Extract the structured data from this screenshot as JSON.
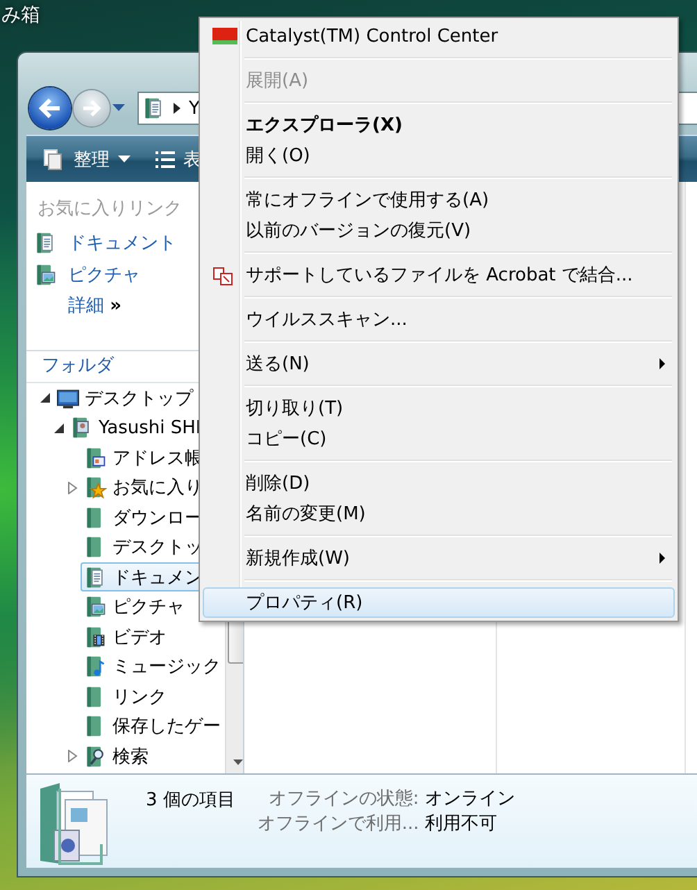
{
  "desktop": {
    "icon_label": "み箱"
  },
  "window": {
    "address": {
      "text": "Y"
    },
    "toolbar": [
      {
        "label": "整理",
        "dropdown": true,
        "kind": "organize"
      },
      {
        "label": "表",
        "dropdown": false,
        "kind": "views"
      }
    ],
    "favorites": {
      "title": "お気に入りリンク",
      "links": [
        {
          "label": "ドキュメント",
          "kind": "documents"
        },
        {
          "label": "ピクチャ",
          "kind": "pictures"
        }
      ],
      "more": "詳細",
      "more_glyph": "»"
    },
    "folders": {
      "title": "フォルダ",
      "tree": [
        {
          "label": "デスクトップ",
          "kind": "desktop",
          "expanded": true,
          "selected": false,
          "children": [
            {
              "label": "Yasushi SHI",
              "kind": "user",
              "expanded": true,
              "selected": false,
              "children": [
                {
                  "label": "アドレス帳",
                  "kind": "contacts",
                  "selected": false
                },
                {
                  "label": "お気に入り",
                  "kind": "favorites",
                  "expanded": false,
                  "selected": false
                },
                {
                  "label": "ダウンロー",
                  "kind": "folder",
                  "selected": false
                },
                {
                  "label": "デスクトッ",
                  "kind": "folder",
                  "selected": false
                },
                {
                  "label": "ドキュメン",
                  "kind": "documents",
                  "selected": true
                },
                {
                  "label": "ピクチャ",
                  "kind": "pictures",
                  "selected": false
                },
                {
                  "label": "ビデオ",
                  "kind": "videos",
                  "selected": false
                },
                {
                  "label": "ミュージック",
                  "kind": "music",
                  "selected": false
                },
                {
                  "label": "リンク",
                  "kind": "folder",
                  "selected": false
                },
                {
                  "label": "保存したゲー",
                  "kind": "folder",
                  "selected": false
                },
                {
                  "label": "検索",
                  "kind": "search",
                  "expanded": false,
                  "selected": false
                }
              ]
            }
          ]
        }
      ]
    },
    "details": {
      "count": "3 個の項目",
      "properties": [
        {
          "label": "オフラインの状態:",
          "value": "オンライン"
        },
        {
          "label": "オフラインで利用...",
          "value": "利用不可"
        }
      ]
    }
  },
  "menu": {
    "groups": [
      [
        {
          "label": "Catalyst(TM) Control Center",
          "kind": "ati",
          "disabled": false,
          "default": false,
          "submenu": false,
          "selected": false
        }
      ],
      [
        {
          "label": "展開(A)",
          "disabled": true,
          "default": false,
          "submenu": false,
          "selected": false
        }
      ],
      [
        {
          "label": "エクスプローラ(X)",
          "disabled": false,
          "default": true,
          "submenu": false,
          "selected": false
        },
        {
          "label": "開く(O)",
          "disabled": false,
          "default": false,
          "submenu": false,
          "selected": false
        }
      ],
      [
        {
          "label": "常にオフラインで使用する(A)",
          "disabled": false,
          "default": false,
          "submenu": false,
          "selected": false
        },
        {
          "label": "以前のバージョンの復元(V)",
          "disabled": false,
          "default": false,
          "submenu": false,
          "selected": false
        }
      ],
      [
        {
          "label": "サポートしているファイルを Acrobat で結合...",
          "kind": "acrobat",
          "disabled": false,
          "default": false,
          "submenu": false,
          "selected": false
        }
      ],
      [
        {
          "label": "ウイルススキャン...",
          "disabled": false,
          "default": false,
          "submenu": false,
          "selected": false
        }
      ],
      [
        {
          "label": "送る(N)",
          "disabled": false,
          "default": false,
          "submenu": true,
          "selected": false
        }
      ],
      [
        {
          "label": "切り取り(T)",
          "disabled": false,
          "default": false,
          "submenu": false,
          "selected": false
        },
        {
          "label": "コピー(C)",
          "disabled": false,
          "default": false,
          "submenu": false,
          "selected": false
        }
      ],
      [
        {
          "label": "削除(D)",
          "disabled": false,
          "default": false,
          "submenu": false,
          "selected": false
        },
        {
          "label": "名前の変更(M)",
          "disabled": false,
          "default": false,
          "submenu": false,
          "selected": false
        }
      ],
      [
        {
          "label": "新規作成(W)",
          "disabled": false,
          "default": false,
          "submenu": true,
          "selected": false
        }
      ],
      [
        {
          "label": "プロパティ(R)",
          "disabled": false,
          "default": false,
          "submenu": false,
          "selected": true
        }
      ]
    ]
  }
}
